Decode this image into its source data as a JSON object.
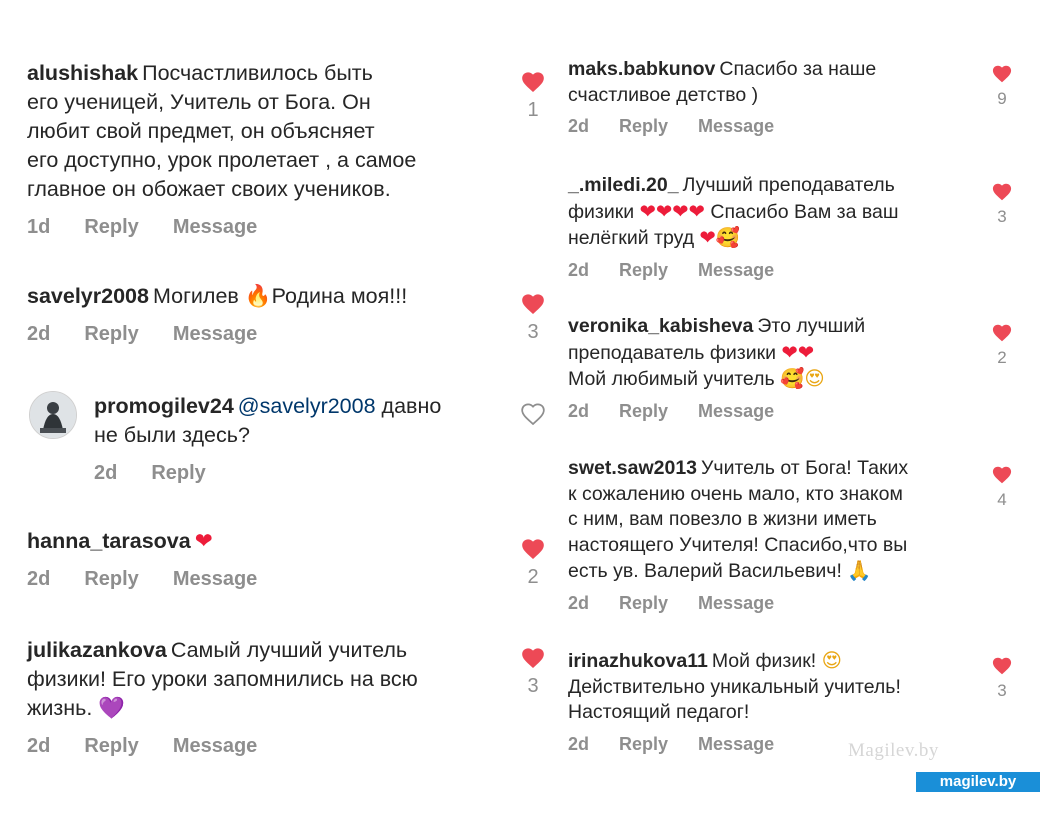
{
  "left_comments": [
    {
      "user": "alushishak",
      "text": "Посчастливилось быть",
      "time": "1d",
      "reply": "Reply",
      "message": "Message",
      "likes": "1"
    },
    {
      "user": "savelyr2008",
      "text": "Могилев",
      "emoji": "🔥",
      "text2": "Родина моя!!!",
      "time": "2d",
      "reply": "Reply",
      "message": "Message",
      "likes": "3"
    },
    {
      "user": "promogilev24",
      "mention": "@savelyr2008",
      "text": "давно",
      "time": "2d",
      "reply": "Reply"
    },
    {
      "user": "hanna_tarasova",
      "emoji": "❤",
      "time": "2d",
      "reply": "Reply",
      "message": "Message",
      "likes": "2"
    },
    {
      "user": "julikazankova",
      "text": "Самый лучший учитель",
      "emoji": "💜",
      "time": "2d",
      "reply": "Reply",
      "message": "Message",
      "likes": "3"
    }
  ],
  "left_lines": {
    "alushishak": [
      "его ученицей, Учитель от Бога. Он",
      "любит свой предмет, он объясняет",
      "его доступно, урок пролетает , а самое",
      "главное он обожает своих учеников."
    ],
    "promogilev24": [
      "не были здесь?"
    ],
    "julikazankova": [
      "физики! Его уроки запомнились на всю",
      "жизнь."
    ]
  },
  "right_comments": [
    {
      "user": "maks.babkunov",
      "text": "Спасибо за наше",
      "line2": "счастливое детство )",
      "time": "2d",
      "reply": "Reply",
      "message": "Message",
      "likes": "9"
    },
    {
      "user": "_.miledi.20_",
      "text": "Лучший преподаватель",
      "line2": "физики",
      "emoji2": "❤❤❤❤",
      "line2b": "Спасибо Вам за ваш",
      "line3": "нелёгкий труд",
      "emoji3": "❤🥰",
      "time": "2d",
      "reply": "Reply",
      "message": "Message",
      "likes": "3"
    },
    {
      "user": "veronika_kabisheva",
      "text": "Это лучший",
      "line2": "преподаватель физики",
      "emoji2": "❤❤",
      "line3": "Мой любимый учитель",
      "emoji3": "🥰😍",
      "time": "2d",
      "reply": "Reply",
      "message": "Message",
      "likes": "2"
    },
    {
      "user": "swet.saw2013",
      "text": "Учитель от Бога! Таких",
      "line2": "к сожалению очень мало, кто знаком",
      "line3": "с ним, вам повезло в жизни иметь",
      "line4": "настоящего Учителя! Спасибо,что вы",
      "line5": "есть ув. Валерий Васильевич!",
      "emoji5": "🙏",
      "time": "2d",
      "reply": "Reply",
      "message": "Message",
      "likes": "4"
    },
    {
      "user": "irinazhukova11",
      "text": "Мой физик!",
      "emoji": "😍",
      "line2": "Действительно уникальный учитель!",
      "line3": "Настоящий педагог!",
      "time": "2d",
      "reply": "Reply",
      "message": "Message",
      "likes": "3"
    }
  ],
  "watermark": {
    "text": "Magilev.by",
    "badge": "magilev.by"
  },
  "colors": {
    "heart": "#ed4956",
    "meta": "#8e8e8e",
    "mention": "#00376b",
    "badge": "#1a8fd8"
  }
}
